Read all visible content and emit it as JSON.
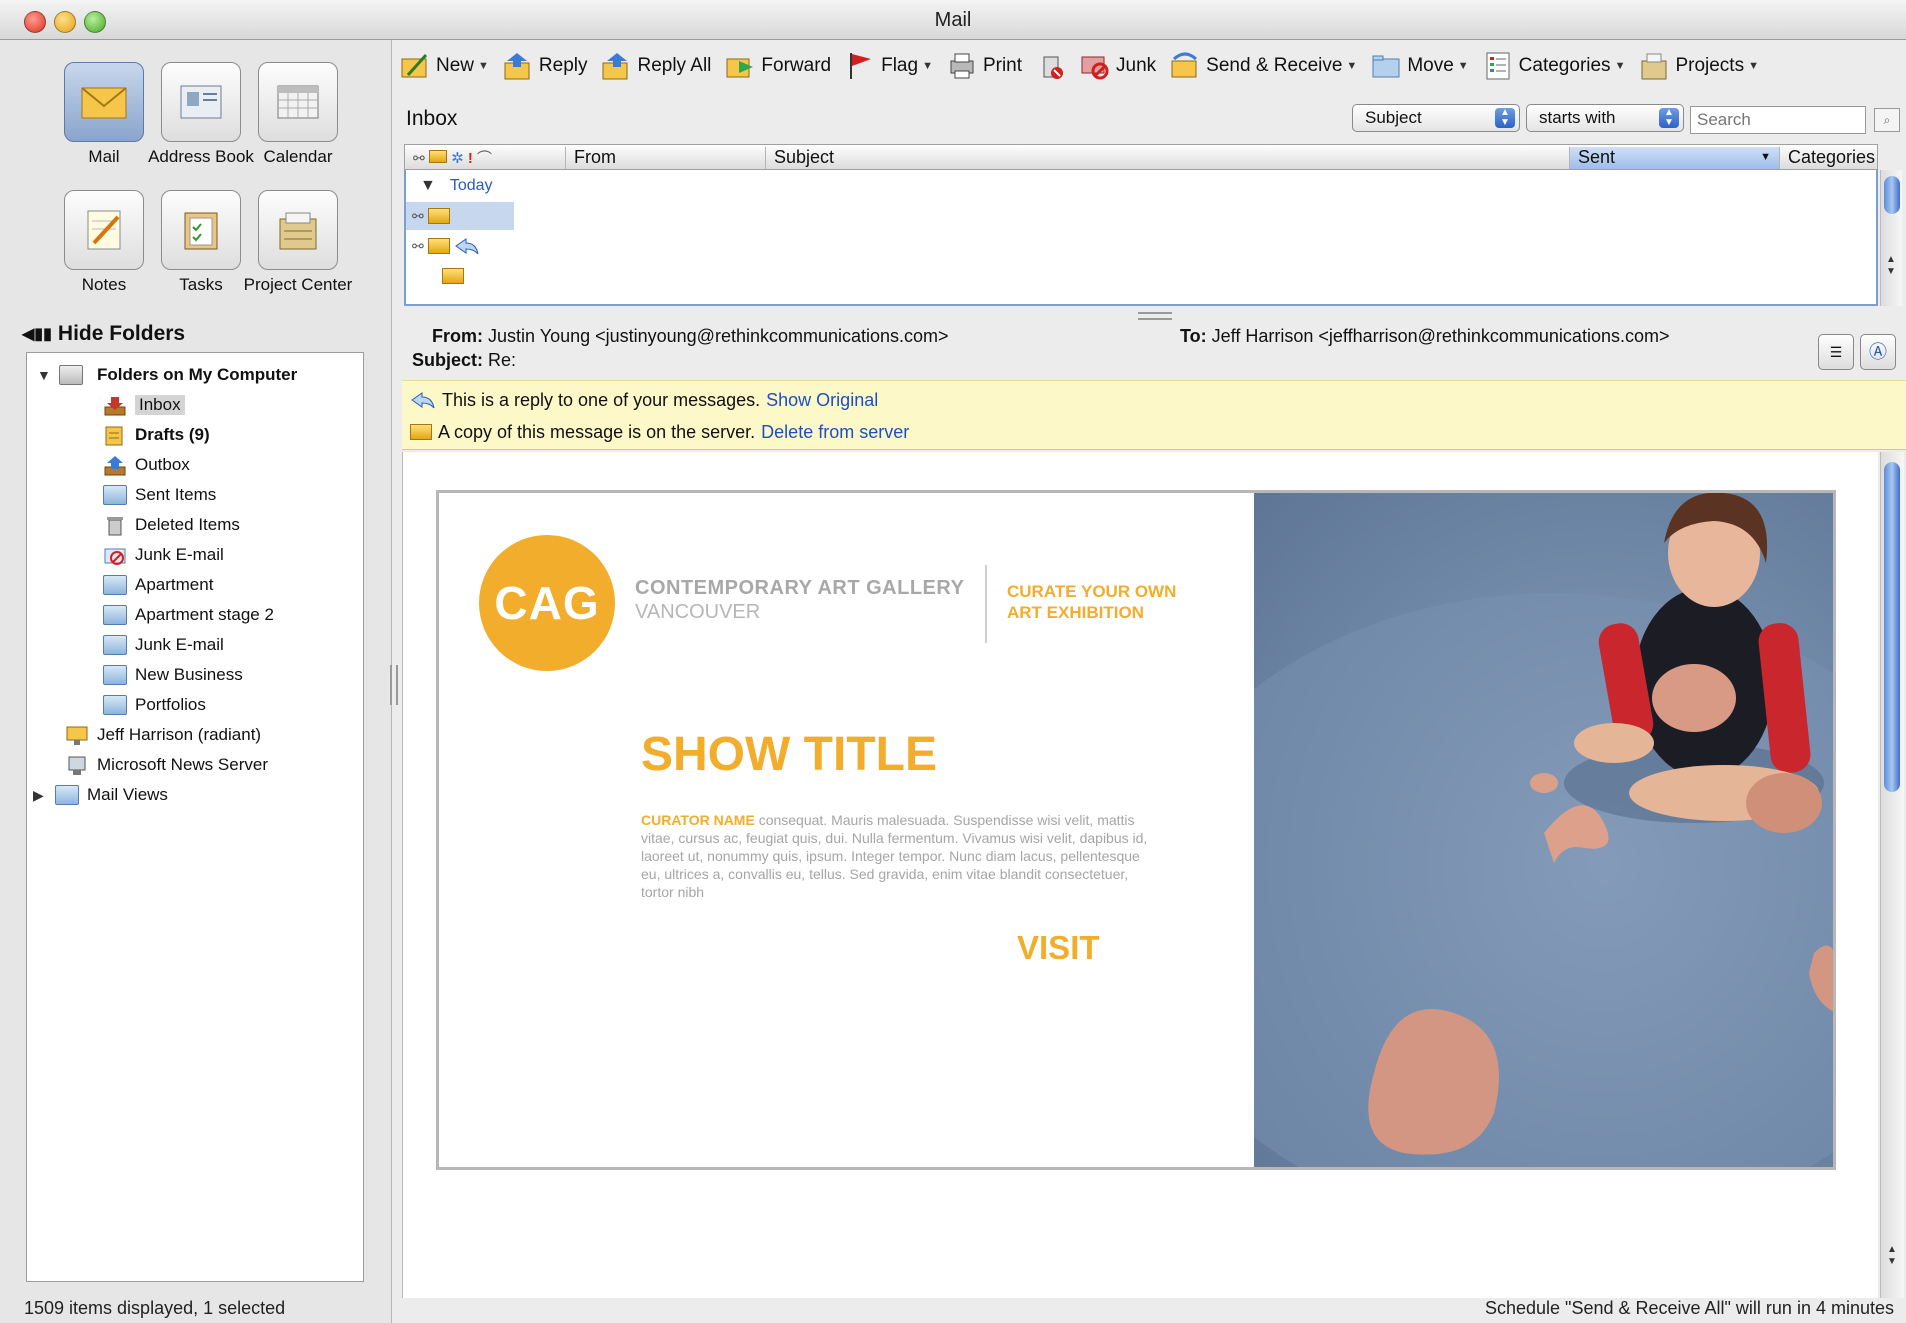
{
  "window": {
    "title": "Mail"
  },
  "nav": {
    "items": [
      {
        "label": "Mail",
        "icon": "mail-icon"
      },
      {
        "label": "Address Book",
        "icon": "address-book-icon"
      },
      {
        "label": "Calendar",
        "icon": "calendar-icon"
      },
      {
        "label": "Notes",
        "icon": "notes-icon"
      },
      {
        "label": "Tasks",
        "icon": "tasks-icon"
      },
      {
        "label": "Project Center",
        "icon": "project-center-icon"
      }
    ],
    "hide_folders": "Hide Folders"
  },
  "folders": {
    "root": "Folders on My Computer",
    "items": [
      {
        "label": "Inbox"
      },
      {
        "label": "Drafts (9)"
      },
      {
        "label": "Outbox"
      },
      {
        "label": "Sent Items"
      },
      {
        "label": "Deleted Items"
      },
      {
        "label": "Junk E-mail"
      },
      {
        "label": "Apartment"
      },
      {
        "label": "Apartment stage 2"
      },
      {
        "label": "Junk E-mail"
      },
      {
        "label": "New Business"
      },
      {
        "label": "Portfolios"
      }
    ],
    "accounts": [
      "Jeff Harrison (radiant)",
      "Microsoft News Server",
      "Mail Views"
    ]
  },
  "toolbar": {
    "new": "New",
    "reply": "Reply",
    "reply_all": "Reply All",
    "forward": "Forward",
    "flag": "Flag",
    "print": "Print",
    "junk": "Junk",
    "send_receive": "Send & Receive",
    "move": "Move",
    "categories": "Categories",
    "projects": "Projects"
  },
  "list": {
    "title": "Inbox",
    "filter_field": "Subject",
    "filter_op": "starts with",
    "search_placeholder": "Search",
    "columns": {
      "from": "From",
      "subject": "Subject",
      "sent": "Sent",
      "categories": "Categories"
    },
    "group": "Today"
  },
  "preview": {
    "from_label": "From:",
    "from_value": "Justin Young <justinyoung@rethinkcommunications.com>",
    "to_label": "To:",
    "to_value": "Jeff Harrison <jeffharrison@rethinkcommunications.com>",
    "subject_label": "Subject:",
    "subject_value": "Re:",
    "notice_reply": "This is a reply to one of your messages.",
    "notice_reply_link": "Show Original",
    "notice_server": "A copy of this message is on the server.",
    "notice_server_link": "Delete from server"
  },
  "email": {
    "logo": "CAG",
    "gallery_name": "CONTEMPORARY ART GALLERY",
    "gallery_city": "VANCOUVER",
    "curate_line1": "CURATE YOUR OWN",
    "curate_line2": "ART EXHIBITION",
    "show_title": "SHOW TITLE",
    "curator_name": "CURATOR NAME",
    "curator_text": " consequat. Mauris malesuada. Suspendisse wisi velit, mattis vitae, cursus ac, feugiat quis, dui. Nulla fermentum. Vivamus wisi velit, dapibus id, laoreet ut, nonummy quis, ipsum. Integer tempor. Nunc diam lacus, pellentesque eu, ultrices a, convallis eu, tellus. Sed gravida, enim vitae blandit consectetuer, tortor nibh",
    "visit": "VISIT"
  },
  "status": {
    "left": "1509 items displayed, 1 selected",
    "right": "Schedule \"Send & Receive All\" will run in 4 minutes"
  },
  "colors": {
    "accent": "#f2ad2c",
    "link": "#1d4fc4",
    "selection": "#7b9fd2",
    "notice_bg": "#fdf8c8"
  }
}
